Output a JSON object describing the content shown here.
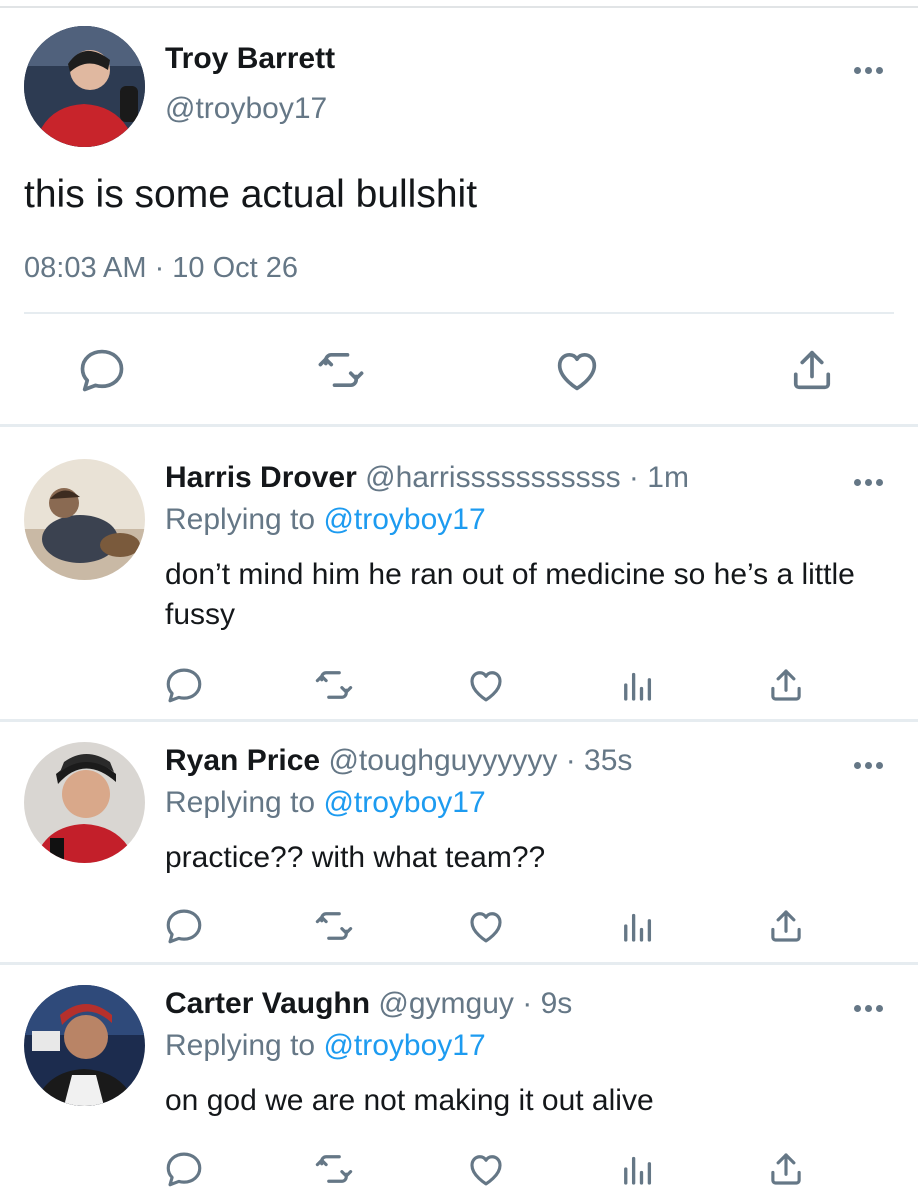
{
  "main_tweet": {
    "author_name": "Troy Barrett",
    "handle": "@troyboy17",
    "text": "this is some actual bullshit",
    "timestamp": "08:03 AM · 10 Oct 26"
  },
  "replies": [
    {
      "author_name": "Harris Drover",
      "handle": "@harrisssssssssss",
      "age": "1m",
      "replying_prefix": "Replying to",
      "replying_to": "@troyboy17",
      "text": "don’t mind him he ran out of medicine so he’s a little fussy"
    },
    {
      "author_name": "Ryan Price",
      "handle": "@toughguyyyyyy",
      "age": "35s",
      "replying_prefix": "Replying to",
      "replying_to": "@troyboy17",
      "text": "practice?? with what team??"
    },
    {
      "author_name": "Carter Vaughn",
      "handle": "@gymguy",
      "age": "9s",
      "replying_prefix": "Replying to",
      "replying_to": "@troyboy17",
      "text": "on god we are not making it out alive"
    }
  ],
  "separator": "·",
  "colors": {
    "text": "#14171a",
    "secondary": "#657786",
    "link": "#1d9bf0",
    "divider": "#e6ecf0"
  },
  "icons": [
    "reply-icon",
    "retweet-icon",
    "like-icon",
    "analytics-icon",
    "share-icon",
    "more-icon"
  ]
}
